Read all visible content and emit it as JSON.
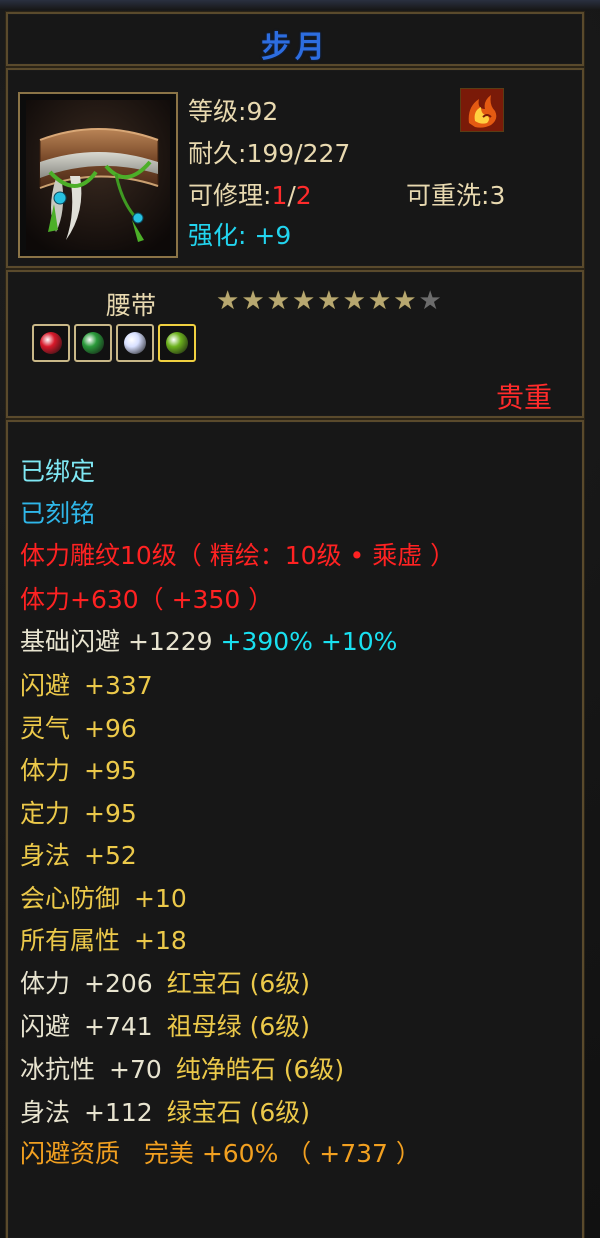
{
  "title": "步月",
  "info": {
    "level_label": "等级:",
    "level_value": "92",
    "durability_label": "耐久:",
    "durability_value": "199/227",
    "repair_label": "可修理:",
    "repair_current": "1",
    "repair_sep": "/",
    "repair_max": "2",
    "rewash_label": "可重洗:",
    "rewash_value": "3",
    "enhance_label": "强化:",
    "enhance_value": "+9",
    "flame_icon": "flame-emblem-icon"
  },
  "item": {
    "slot": "腰带",
    "stars_total": 9,
    "stars_filled": 8,
    "gems": [
      {
        "name": "red-gem-icon",
        "color": "#d8192a"
      },
      {
        "name": "green-gem-icon",
        "color": "#2a9a3a"
      },
      {
        "name": "white-gem-icon",
        "color": "#d8e0ff"
      },
      {
        "name": "lime-gem-icon",
        "color": "#6db21e"
      }
    ],
    "rarity": "贵重"
  },
  "attributes": {
    "bound": "已绑定",
    "engraved": "已刻铭",
    "carving": "体力雕纹10级（ 精绘：10级 • 乘虚 ）",
    "stamina_total": "体力+630（ +350 ）",
    "base_dodge_label": "基础闪避",
    "base_dodge_value": "+1229",
    "base_dodge_pct1": "+390%",
    "base_dodge_pct2": "+10%",
    "rows": [
      {
        "label": "闪避",
        "value": "+337"
      },
      {
        "label": "灵气",
        "value": "+96"
      },
      {
        "label": "体力",
        "value": "+95"
      },
      {
        "label": "定力",
        "value": "+95"
      },
      {
        "label": "身法",
        "value": "+52"
      },
      {
        "label": "会心防御",
        "value": "+10"
      },
      {
        "label": "所有属性",
        "value": "+18"
      }
    ],
    "gem_rows": [
      {
        "label": "体力",
        "value": "+206",
        "gem": "红宝石 (6级)"
      },
      {
        "label": "闪避",
        "value": "+741",
        "gem": "祖母绿 (6级)"
      },
      {
        "label": "冰抗性",
        "value": "+70",
        "gem": "纯净皓石 (6级)"
      },
      {
        "label": "身法",
        "value": "+112",
        "gem": "绿宝石 (6级)"
      }
    ],
    "aptitude_label": "闪避资质",
    "aptitude_grade": "完美",
    "aptitude_pct": "+60%",
    "aptitude_bonus": "（ +737 ）"
  },
  "colors": {
    "title": "#2d6de0",
    "red": "#ff2b2b",
    "cyan": "#22d4ee",
    "yellow": "#ecc94a",
    "orange": "#f2a020",
    "frame": "#5a4a2c"
  }
}
